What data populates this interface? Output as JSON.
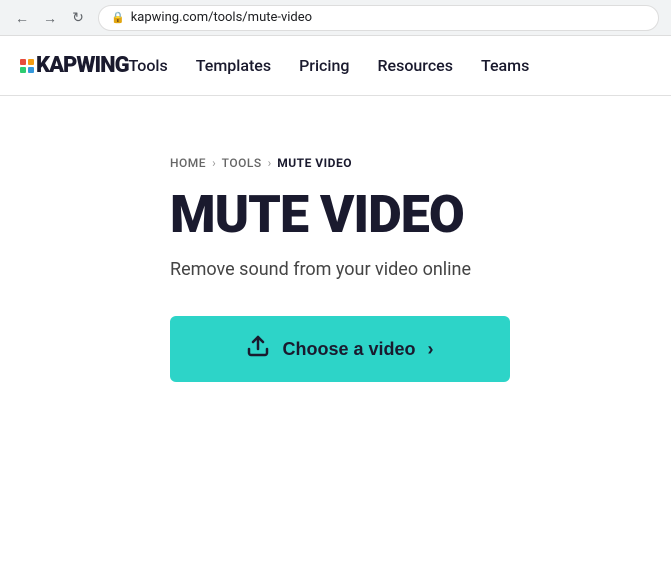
{
  "browser": {
    "url": "kapwing.com/tools/mute-video",
    "lock_symbol": "🔒"
  },
  "navbar": {
    "logo_text": "KAPWING",
    "nav_items": [
      {
        "label": "Tools",
        "href": "#"
      },
      {
        "label": "Templates",
        "href": "#"
      },
      {
        "label": "Pricing",
        "href": "#"
      },
      {
        "label": "Resources",
        "href": "#"
      },
      {
        "label": "Teams",
        "href": "#"
      }
    ]
  },
  "breadcrumb": {
    "home": "HOME",
    "tools": "TOOLS",
    "current": "MUTE VIDEO"
  },
  "hero": {
    "title": "MUTE VIDEO",
    "subtitle": "Remove sound from your video online",
    "cta_label": "Choose a video"
  },
  "colors": {
    "teal": "#2dd4c8",
    "dark": "#1a1a2e",
    "logo_red": "#e74c3c",
    "logo_yellow": "#f39c12",
    "logo_green": "#2ecc71",
    "logo_blue": "#3498db"
  }
}
